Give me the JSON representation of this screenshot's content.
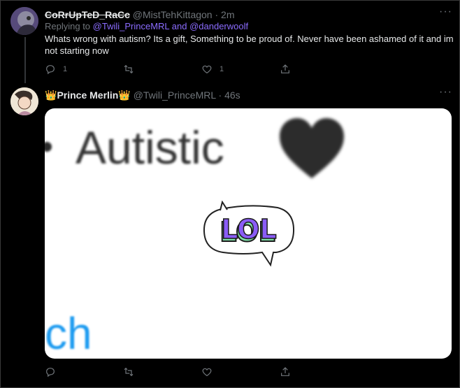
{
  "tweet1": {
    "display_name": "CoRrUpTeD_RaCc",
    "handle": "@MistTehKittagon",
    "separator": "·",
    "time": "2m",
    "replying_prefix": "Replying to ",
    "replying_users": "@Twili_PrinceMRL and @danderwoolf",
    "text": "Whats wrong with autism? Its a gift, Something to be proud of. Never have been ashamed of it and im not starting now",
    "reply_count": "1",
    "like_count": "1"
  },
  "tweet2": {
    "crown_left": "👑",
    "display_name": "Prince Merlin",
    "crown_right": "👑",
    "handle": "@Twili_PrinceMRL",
    "separator": "·",
    "time": "46s",
    "media": {
      "text_top": "Autistic",
      "text_bottom": "ch",
      "sticker_text": "LOL"
    }
  },
  "more_label": "···",
  "colors": {
    "background": "#000000",
    "link": "#8b6cff",
    "muted": "#71767b",
    "blue": "#1d9bf0",
    "sticker_purple": "#8a5cf6",
    "sticker_green": "#7fe0a8"
  }
}
